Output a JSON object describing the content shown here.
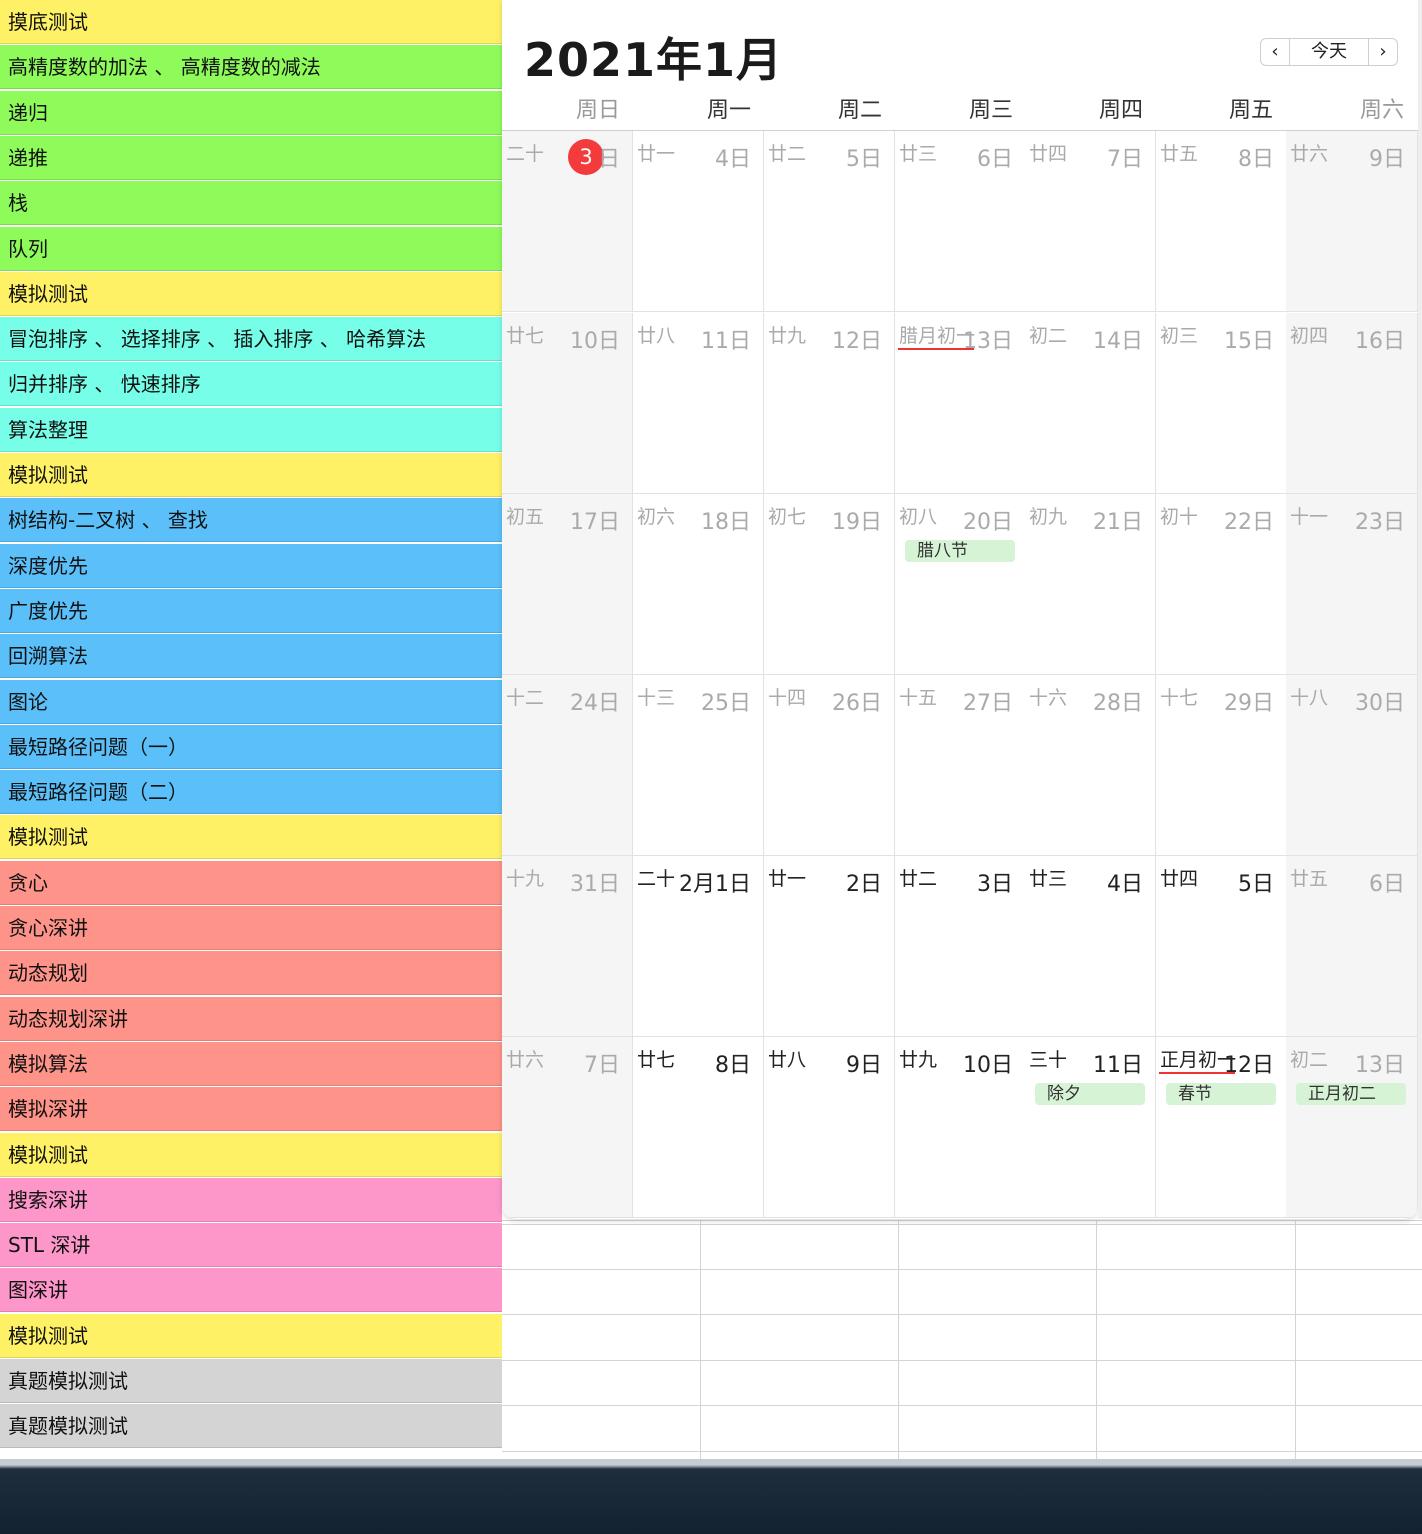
{
  "topics": [
    {
      "label": "摸底测试",
      "color": "#fff165"
    },
    {
      "label": "高精度数的加法 、 高精度数的减法",
      "color": "#8efb5b"
    },
    {
      "label": "递归",
      "color": "#8efb5b"
    },
    {
      "label": "递推",
      "color": "#8efb5b"
    },
    {
      "label": "栈",
      "color": "#8efb5b"
    },
    {
      "label": "队列",
      "color": "#8efb5b"
    },
    {
      "label": "模拟测试",
      "color": "#fff165"
    },
    {
      "label": "冒泡排序 、 选择排序 、 插入排序 、 哈希算法",
      "color": "#76fee9"
    },
    {
      "label": "归并排序 、 快速排序",
      "color": "#76fee9"
    },
    {
      "label": "算法整理",
      "color": "#76fee9"
    },
    {
      "label": "模拟测试",
      "color": "#fff165"
    },
    {
      "label": "树结构-二叉树 、 查找",
      "color": "#5bc0fa"
    },
    {
      "label": "深度优先",
      "color": "#5bc0fa"
    },
    {
      "label": "广度优先",
      "color": "#5bc0fa"
    },
    {
      "label": "回溯算法",
      "color": "#5bc0fa"
    },
    {
      "label": "图论",
      "color": "#5bc0fa"
    },
    {
      "label": "最短路径问题（一）",
      "color": "#5bc0fa"
    },
    {
      "label": "最短路径问题（二）",
      "color": "#5bc0fa"
    },
    {
      "label": "模拟测试",
      "color": "#fff165"
    },
    {
      "label": "贪心",
      "color": "#fd9389"
    },
    {
      "label": "贪心深讲",
      "color": "#fd9389"
    },
    {
      "label": "动态规划",
      "color": "#fd9389"
    },
    {
      "label": "动态规划深讲",
      "color": "#fd9389"
    },
    {
      "label": "模拟算法",
      "color": "#fd9389"
    },
    {
      "label": "模拟深讲",
      "color": "#fd9389"
    },
    {
      "label": "模拟测试",
      "color": "#fff165"
    },
    {
      "label": "搜索深讲",
      "color": "#fd96c9"
    },
    {
      "label": "STL 深讲",
      "color": "#fd96c9"
    },
    {
      "label": "图深讲",
      "color": "#fd96c9"
    },
    {
      "label": "模拟测试",
      "color": "#fff165"
    },
    {
      "label": "真题模拟测试",
      "color": "#d4d4d4"
    },
    {
      "label": "真题模拟测试",
      "color": "#d4d4d4"
    }
  ],
  "calendar": {
    "title": "2021年1月",
    "prev_icon": "chevron-left-icon",
    "prev_glyph": "‹",
    "today_label": "今天",
    "next_icon": "chevron-right-icon",
    "next_glyph": "›",
    "today_color": "#f33b3b",
    "event_color": "#d6f3d6",
    "weekdays": [
      "周日",
      "周一",
      "周二",
      "周三",
      "周四",
      "周五",
      "周六"
    ],
    "weeks": [
      [
        {
          "lunar": "二十",
          "solar": "日",
          "today_num": "3"
        },
        {
          "lunar": "廿一",
          "solar": "4日"
        },
        {
          "lunar": "廿二",
          "solar": "5日"
        },
        {
          "lunar": "廿三",
          "solar": "6日"
        },
        {
          "lunar": "廿四",
          "solar": "7日"
        },
        {
          "lunar": "廿五",
          "solar": "8日"
        },
        {
          "lunar": "廿六",
          "solar": "9日"
        }
      ],
      [
        {
          "lunar": "廿七",
          "solar": "10日"
        },
        {
          "lunar": "廿八",
          "solar": "11日"
        },
        {
          "lunar": "廿九",
          "solar": "12日"
        },
        {
          "lunar": "腊月初一",
          "solar": "13日",
          "month_start": true
        },
        {
          "lunar": "初二",
          "solar": "14日"
        },
        {
          "lunar": "初三",
          "solar": "15日"
        },
        {
          "lunar": "初四",
          "solar": "16日"
        }
      ],
      [
        {
          "lunar": "初五",
          "solar": "17日"
        },
        {
          "lunar": "初六",
          "solar": "18日"
        },
        {
          "lunar": "初七",
          "solar": "19日"
        },
        {
          "lunar": "初八",
          "solar": "20日",
          "event": "腊八节"
        },
        {
          "lunar": "初九",
          "solar": "21日"
        },
        {
          "lunar": "初十",
          "solar": "22日"
        },
        {
          "lunar": "十一",
          "solar": "23日"
        }
      ],
      [
        {
          "lunar": "十二",
          "solar": "24日"
        },
        {
          "lunar": "十三",
          "solar": "25日"
        },
        {
          "lunar": "十四",
          "solar": "26日"
        },
        {
          "lunar": "十五",
          "solar": "27日"
        },
        {
          "lunar": "十六",
          "solar": "28日"
        },
        {
          "lunar": "十七",
          "solar": "29日"
        },
        {
          "lunar": "十八",
          "solar": "30日"
        }
      ],
      [
        {
          "lunar": "十九",
          "solar": "31日"
        },
        {
          "lunar": "二十",
          "solar": "2月1日",
          "strong": true
        },
        {
          "lunar": "廿一",
          "solar": "2日",
          "strong": true
        },
        {
          "lunar": "廿二",
          "solar": "3日",
          "strong": true
        },
        {
          "lunar": "廿三",
          "solar": "4日",
          "strong": true
        },
        {
          "lunar": "廿四",
          "solar": "5日",
          "strong": true
        },
        {
          "lunar": "廿五",
          "solar": "6日"
        }
      ],
      [
        {
          "lunar": "廿六",
          "solar": "7日"
        },
        {
          "lunar": "廿七",
          "solar": "8日",
          "strong": true
        },
        {
          "lunar": "廿八",
          "solar": "9日",
          "strong": true
        },
        {
          "lunar": "廿九",
          "solar": "10日",
          "strong": true
        },
        {
          "lunar": "三十",
          "solar": "11日",
          "strong": true,
          "event": "除夕"
        },
        {
          "lunar": "正月初一",
          "solar": "12日",
          "strong": true,
          "month_start": true,
          "event": "春节"
        },
        {
          "lunar": "初二",
          "solar": "13日",
          "event": "正月初二"
        }
      ]
    ]
  }
}
